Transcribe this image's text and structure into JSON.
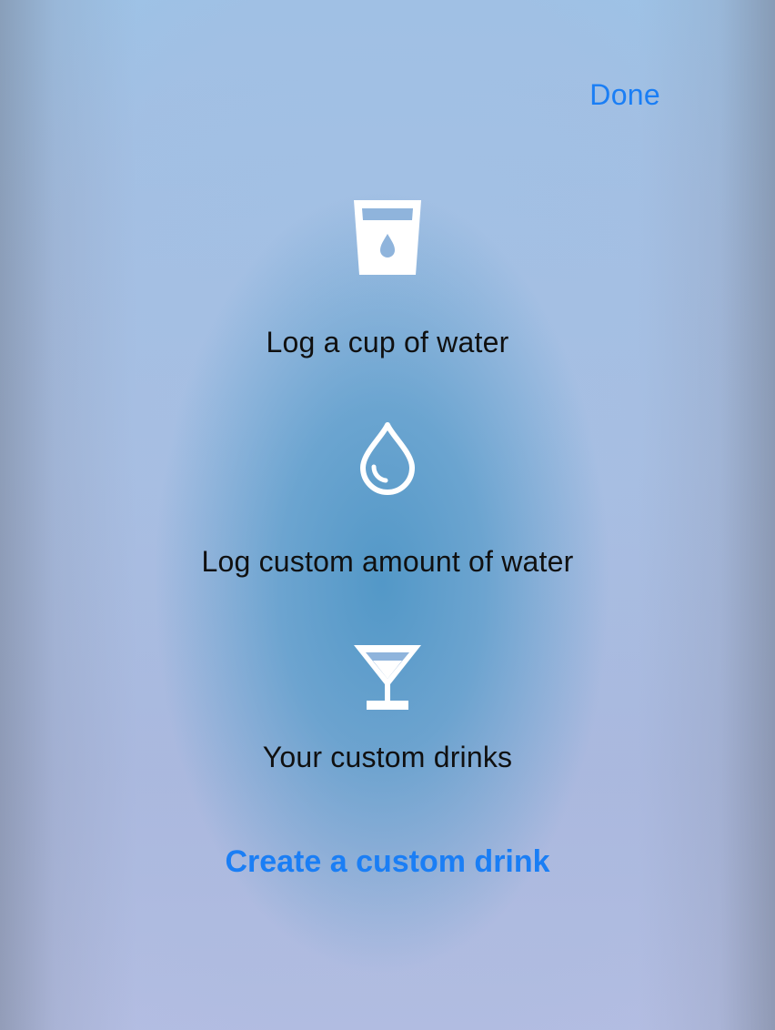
{
  "header": {
    "done_label": "Done"
  },
  "options": [
    {
      "label": "Log a cup of water",
      "icon": "water-cup-icon"
    },
    {
      "label": "Log custom amount of water",
      "icon": "water-drop-icon"
    },
    {
      "label": "Your custom drinks",
      "icon": "cocktail-glass-icon"
    }
  ],
  "create_link": {
    "label": "Create a custom drink"
  },
  "colors": {
    "accent": "#1a7ef5",
    "text": "#101010",
    "icon": "#ffffff"
  }
}
